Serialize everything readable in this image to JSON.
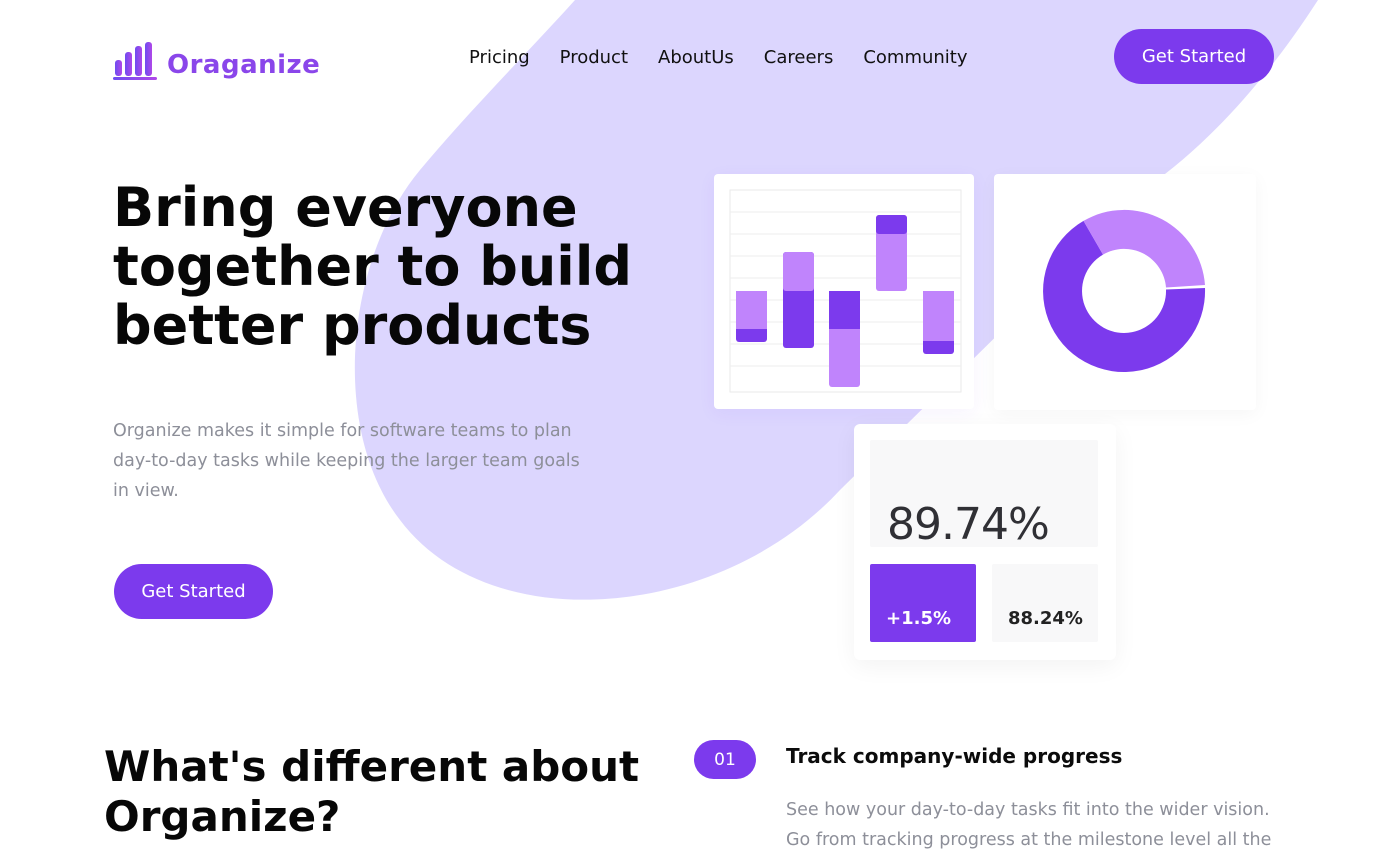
{
  "brand": {
    "name": "Oraganize",
    "color": "#7c3aed",
    "icon": "bar-chart-logo-icon"
  },
  "nav": {
    "items": [
      "Pricing",
      "Product",
      "AboutUs",
      "Careers",
      "Community"
    ]
  },
  "header": {
    "cta_label": "Get Started"
  },
  "hero": {
    "title": "Bring everyone together to build better products",
    "subtitle": "Organize makes it simple for software teams to plan day-to-day tasks while keeping the larger team goals in view.",
    "cta_label": "Get Started"
  },
  "stats": {
    "main": "89.74%",
    "change": "+1.5%",
    "secondary": "88.24%"
  },
  "features": {
    "heading": "What's different about Organize?",
    "items": [
      {
        "number": "01",
        "title": "Track company-wide progress",
        "description": "See how your day-to-day tasks fit into the wider vision. Go from tracking progress at the milestone level all the"
      }
    ]
  },
  "colors": {
    "accent": "#7c3aed",
    "accent_light": "#c084fc",
    "blob": "#dcd6fe",
    "muted_text": "#8d8f99"
  }
}
